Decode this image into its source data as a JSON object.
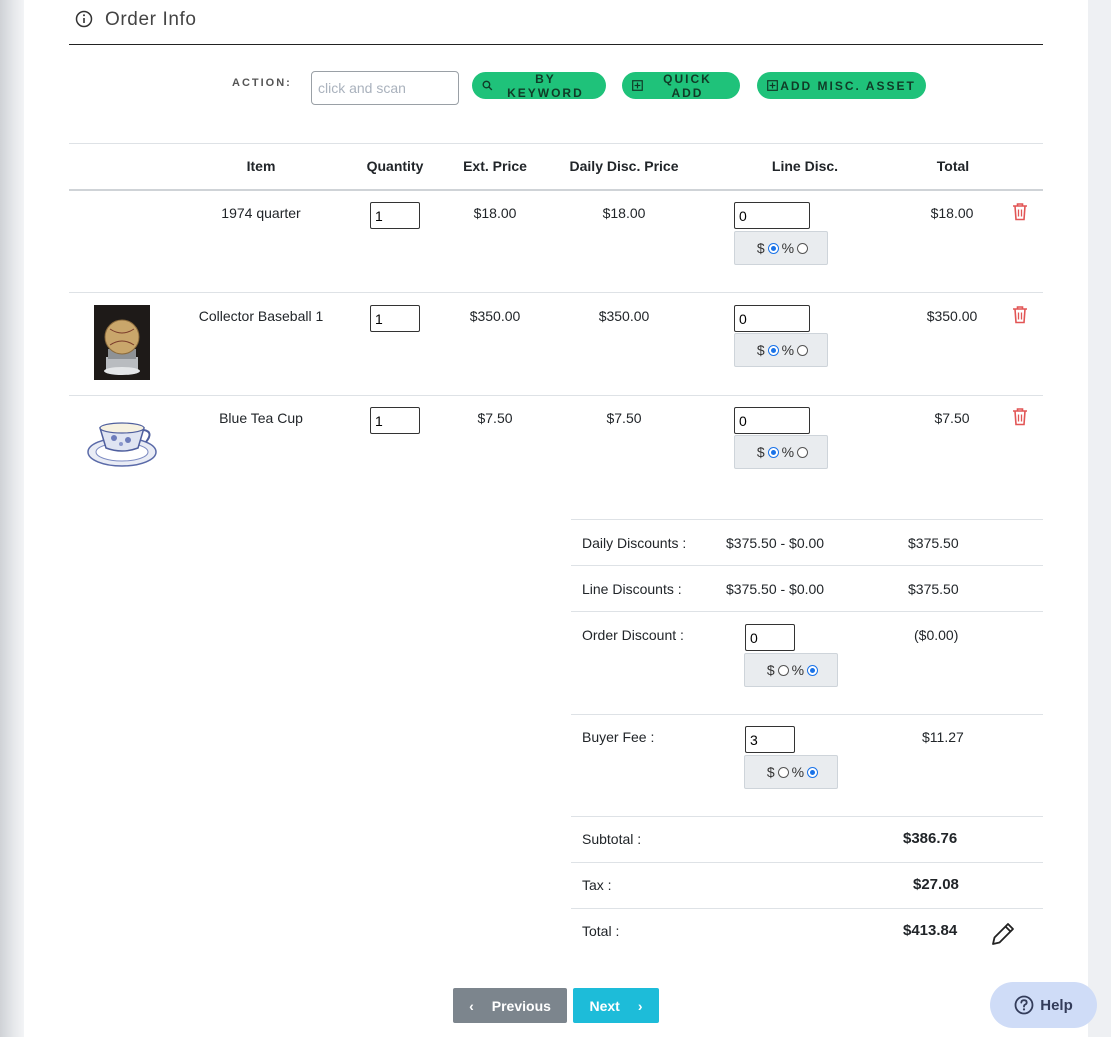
{
  "header": {
    "title": "Order Info"
  },
  "action": {
    "label": "ACTION:",
    "scan_placeholder": "click and scan",
    "by_keyword": "BY KEYWORD",
    "quick_add": "QUICK ADD",
    "add_misc": "ADD MISC. ASSET"
  },
  "table": {
    "headers": [
      "Item",
      "Quantity",
      "Ext. Price",
      "Daily Disc. Price",
      "Line Disc.",
      "Total"
    ],
    "rows": [
      {
        "name": "1974 quarter",
        "qty": "1",
        "ext_price": "$18.00",
        "daily_disc": "$18.00",
        "line_disc": "0",
        "total": "$18.00"
      },
      {
        "name": "Collector Baseball 1",
        "qty": "1",
        "ext_price": "$350.00",
        "daily_disc": "$350.00",
        "line_disc": "0",
        "total": "$350.00"
      },
      {
        "name": "Blue Tea Cup",
        "qty": "1",
        "ext_price": "$7.50",
        "daily_disc": "$7.50",
        "line_disc": "0",
        "total": "$7.50"
      }
    ],
    "toggle_dollar": "$",
    "toggle_percent": "%"
  },
  "summary": {
    "daily_label": "Daily Discounts :",
    "daily_mid": "$375.50 - $0.00",
    "daily_val": "$375.50",
    "line_label": "Line Discounts :",
    "line_mid": "$375.50 - $0.00",
    "line_val": "$375.50",
    "order_label": "Order Discount :",
    "order_input": "0",
    "order_val": "($0.00)",
    "buyer_label": "Buyer Fee :",
    "buyer_input": "3",
    "buyer_val": "$11.27",
    "subtotal_label": "Subtotal :",
    "subtotal_val": "$386.76",
    "tax_label": "Tax :",
    "tax_val": "$27.08",
    "total_label": "Total :",
    "total_val": "$413.84"
  },
  "nav": {
    "previous": "Previous",
    "next": "Next"
  },
  "help": {
    "label": "Help"
  },
  "colors": {
    "accent_green": "#1fc27a",
    "next_blue": "#1dbcd9",
    "trash_red": "#e25555",
    "radio_blue": "#1a73e8"
  }
}
